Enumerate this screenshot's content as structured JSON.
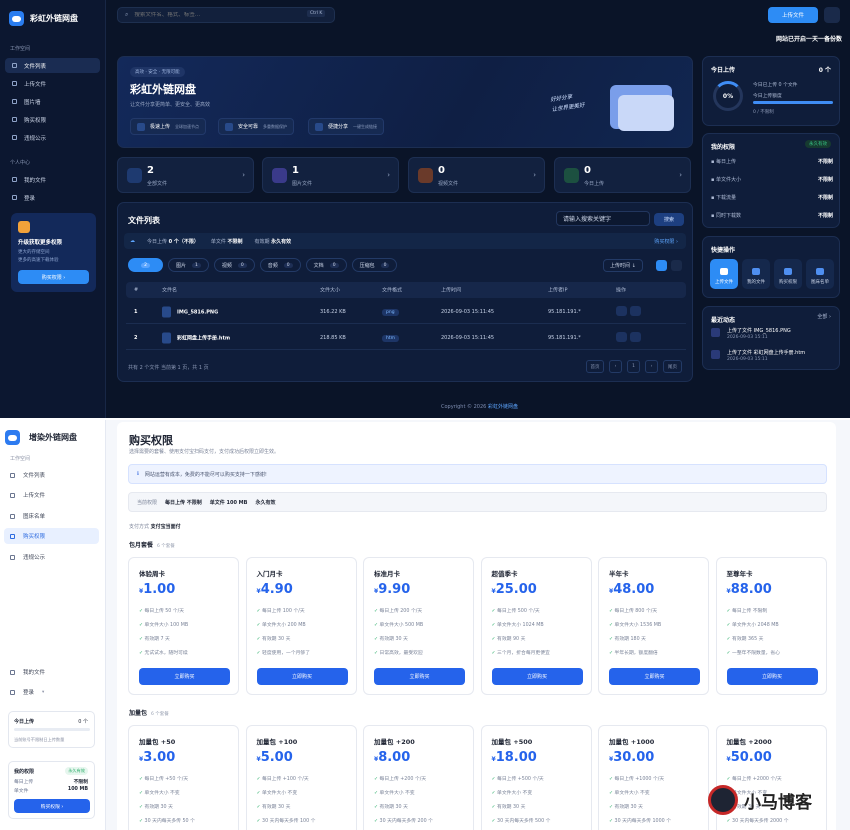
{
  "dark": {
    "logo": "彩虹外链网盘",
    "sidebar": {
      "sec1": "工作空间",
      "items": [
        "文件列表",
        "上传文件",
        "图片墙",
        "购买权限",
        "违规公示"
      ],
      "sec2": "个人中心",
      "items2": [
        "我的文件",
        "登录"
      ],
      "upgrade": {
        "title": "升级获取更多权限",
        "d1": "更大的存储空间",
        "d2": "更多的高速下载体验",
        "btn": "购买权限 ›"
      }
    },
    "search_placeholder": "搜索文件名、格式、标签...",
    "kbd": "Ctrl K",
    "upload": "上传文件",
    "marquee": "网站已开启一天一备份数",
    "hero": {
      "pill": "高效 · 安全 · 无限可能",
      "title": "彩虹外链网盘",
      "sub": "让文件分享更简单、更安全、更高效",
      "features": [
        {
          "t": "极速上传",
          "d": "全球加速节点"
        },
        {
          "t": "安全可靠",
          "d": "多重数据保护"
        },
        {
          "t": "便捷分享",
          "d": "一键生成链接"
        }
      ],
      "slogan1": "好好分享",
      "slogan2": "让世界更美好"
    },
    "stats": [
      {
        "n": "2",
        "l": "全部文件",
        "c": "#1e3a70"
      },
      {
        "n": "1",
        "l": "图片文件",
        "c": "#3a3a8a"
      },
      {
        "n": "0",
        "l": "视频文件",
        "c": "#6a3a2a"
      },
      {
        "n": "0",
        "l": "今日上传",
        "c": "#1c5040"
      }
    ],
    "files": {
      "title": "文件列表",
      "search": "请输入搜索关键字",
      "search_btn": "搜索",
      "quota": {
        "today": "今日上传",
        "today_v": "0 个（不限）",
        "single": "单文件",
        "single_v": "不限制",
        "valid": "有效期",
        "valid_v": "永久有效",
        "buy": "购买权限 ›"
      },
      "tabs": [
        {
          "l": "",
          "c": "2"
        },
        {
          "l": "图片",
          "c": "1"
        },
        {
          "l": "视频",
          "c": "0"
        },
        {
          "l": "音频",
          "c": "0"
        },
        {
          "l": "文档",
          "c": "0"
        },
        {
          "l": "压缩包",
          "c": "0"
        }
      ],
      "sort": "上传时间 ↓",
      "headers": [
        "#",
        "文件名",
        "文件大小",
        "文件格式",
        "上传时间",
        "上传者IP",
        "操作"
      ],
      "rows": [
        {
          "i": "1",
          "name": "IMG_5816.PNG",
          "size": "316.22 KB",
          "fmt": "png",
          "time": "2026-09-03 15:11:45",
          "ip": "95.181.191.*"
        },
        {
          "i": "2",
          "name": "彩虹网盘上传手册.htm",
          "size": "218.85 KB",
          "fmt": "htm",
          "time": "2026-09-03 15:11:45",
          "ip": "95.181.191.*"
        }
      ],
      "foot": "共有 2 个文件 当前第 1 页，共 1 页",
      "pages": [
        "首页",
        "‹",
        "1",
        "›",
        "尾页"
      ]
    },
    "copyright": "Copyright © 2026",
    "copyright_link": "彩虹外链网盘",
    "today": {
      "title": "今日上传",
      "count": "0 个",
      "pct": "0%",
      "l1": "今日已上传 0 个文件",
      "l2": "今日上传额度",
      "l3": "0 / 不限制"
    },
    "perm": {
      "title": "我的权限",
      "badge": "永久有效",
      "rows": [
        {
          "k": "每日上传",
          "v": "不限制"
        },
        {
          "k": "单文件大小",
          "v": "不限制"
        },
        {
          "k": "下载流量",
          "v": "不限制"
        },
        {
          "k": "同时下载数",
          "v": "不限制"
        }
      ]
    },
    "quick": {
      "title": "快捷操作",
      "items": [
        "上传文件",
        "我的文件",
        "购买权限",
        "图床名单"
      ]
    },
    "recent": {
      "title": "最近动态",
      "all": "全部 ›",
      "items": [
        {
          "t": "上传了文件 IMG_5816.PNG",
          "d": "2026-09-03 15:11"
        },
        {
          "t": "上传了文件 彩虹网盘上传手册.htm",
          "d": "2026-09-03 15:11"
        }
      ]
    }
  },
  "light": {
    "logo": "增染外链网盘",
    "sec": "工作空间",
    "nav": [
      "文件列表",
      "上传文件",
      "图床名单",
      "购买权限",
      "违规公示"
    ],
    "nav2": [
      "我的文件",
      "登录"
    ],
    "today": {
      "t": "今日上传",
      "v": "0 个",
      "d": "当前账号不限制日上传数量"
    },
    "perm": {
      "t": "我的权限",
      "badge": "永久有效",
      "k1": "每日上传",
      "v1": "不限制",
      "k2": "单文件",
      "v2": "100 MB",
      "btn": "购买权限 ›"
    },
    "title": "购买权限",
    "sub": "选择需要的套餐、使用支付宝扫码支付，支付成功后权限立即生效。",
    "notice": "网站运营有成本，免费的不能尽可以购买支持一下感谢!",
    "cur_label": "当前权限",
    "cur1": "每日上传 不限制",
    "cur2": "单文件 100 MB",
    "cur3": "永久有效",
    "pay_label": "支付方式",
    "pay": "支付宝当面付",
    "g1": "包月套餐",
    "g1c": "6 个套餐",
    "g2": "加量包",
    "g2c": "6 个套餐",
    "plans": [
      {
        "n": "体验周卡",
        "p": "1.00",
        "f": [
          "每日上传 50 个/天",
          "单文件大小 100 MB",
          "有效期 7 天",
          "无试试水，随时可续"
        ]
      },
      {
        "n": "入门月卡",
        "p": "4.90",
        "f": [
          "每日上传 100 个/天",
          "单文件大小 200 MB",
          "有效期 30 天",
          "轻度使用，一个月够了"
        ]
      },
      {
        "n": "标准月卡",
        "p": "9.90",
        "f": [
          "每日上传 200 个/天",
          "单文件大小 500 MB",
          "有效期 30 天",
          "日常高效，最受欢迎"
        ]
      },
      {
        "n": "超值季卡",
        "p": "25.00",
        "f": [
          "每日上传 500 个/天",
          "单文件大小 1024 MB",
          "有效期 90 天",
          "三个月，折合每月更便宜"
        ]
      },
      {
        "n": "半年卡",
        "p": "48.00",
        "f": [
          "每日上传 800 个/天",
          "单文件大小 1536 MB",
          "有效期 180 天",
          "半年长期，额度翻倍"
        ]
      },
      {
        "n": "至尊年卡",
        "p": "88.00",
        "f": [
          "每日上传 不限制",
          "单文件大小 2048 MB",
          "有效期 365 天",
          "一整年不限数量，省心"
        ]
      }
    ],
    "packs": [
      {
        "n": "加量包 +50",
        "p": "3.00",
        "f": [
          "每日上传 +50 个/天",
          "单文件大小 不变",
          "有效期 30 天",
          "30 天内每天多传 50 个"
        ]
      },
      {
        "n": "加量包 +100",
        "p": "5.00",
        "f": [
          "每日上传 +100 个/天",
          "单文件大小 不变",
          "有效期 30 天",
          "30 天内每天多传 100 个"
        ]
      },
      {
        "n": "加量包 +200",
        "p": "8.00",
        "f": [
          "每日上传 +200 个/天",
          "单文件大小 不变",
          "有效期 30 天",
          "30 天内每天多传 200 个"
        ]
      },
      {
        "n": "加量包 +500",
        "p": "18.00",
        "f": [
          "每日上传 +500 个/天",
          "单文件大小 不变",
          "有效期 30 天",
          "30 天内每天多传 500 个"
        ]
      },
      {
        "n": "加量包 +1000",
        "p": "30.00",
        "f": [
          "每日上传 +1000 个/天",
          "单文件大小 不变",
          "有效期 30 天",
          "30 天内每天多传 1000 个"
        ]
      },
      {
        "n": "加量包 +2000",
        "p": "50.00",
        "f": [
          "每日上传 +2000 个/天",
          "单文件大小 不变",
          "有效期 30 天",
          "30 天内每天多传 2000 个"
        ]
      }
    ],
    "buy": "立即购买",
    "currency": "¥",
    "watermark": "小马博客"
  }
}
